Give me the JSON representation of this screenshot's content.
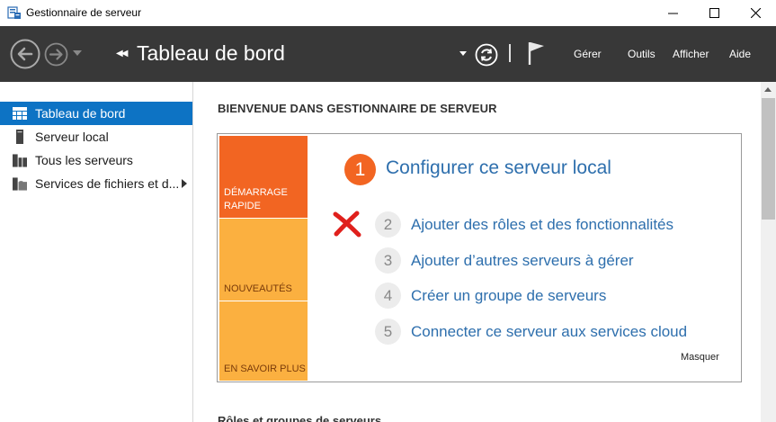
{
  "window": {
    "title": "Gestionnaire de serveur"
  },
  "header": {
    "page_title": "Tableau de bord",
    "menu": {
      "gerer": "Gérer",
      "outils": "Outils",
      "afficher": "Afficher",
      "aide": "Aide"
    }
  },
  "sidebar": {
    "items": [
      {
        "label": "Tableau de bord",
        "icon": "dashboard-icon",
        "active": true
      },
      {
        "label": "Serveur local",
        "icon": "server-icon",
        "active": false
      },
      {
        "label": "Tous les serveurs",
        "icon": "servers-icon",
        "active": false
      },
      {
        "label": "Services de fichiers et d...",
        "icon": "file-services-icon",
        "active": false
      }
    ]
  },
  "main": {
    "welcome_heading": "BIENVENUE DANS GESTIONNAIRE DE SERVEUR",
    "tiles": [
      "DÉMARRAGE RAPIDE",
      "NOUVEAUTÉS",
      "EN SAVOIR PLUS"
    ],
    "steps": [
      {
        "number": "1",
        "label": "Configurer ce serveur local"
      },
      {
        "number": "2",
        "label": "Ajouter des rôles et des fonctionnalités"
      },
      {
        "number": "3",
        "label": "Ajouter d’autres serveurs à gérer"
      },
      {
        "number": "4",
        "label": "Créer un groupe de serveurs"
      },
      {
        "number": "5",
        "label": "Connecter ce serveur aux services cloud"
      }
    ],
    "hide_label": "Masquer",
    "roles_heading": "Rôles et groupes de serveurs"
  },
  "colors": {
    "header_bg": "#383838",
    "accent_blue": "#0d73c4",
    "link_blue": "#2e6fad",
    "orange": "#f26522",
    "light_orange": "#fbb040",
    "annotation_red": "#e0201c"
  }
}
